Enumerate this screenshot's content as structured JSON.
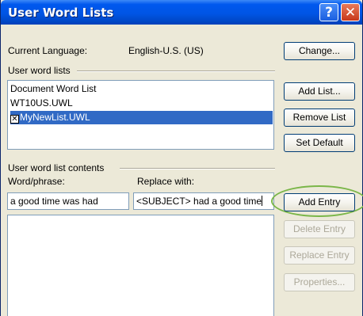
{
  "window": {
    "title": "User Word Lists"
  },
  "titlebar": {
    "help_glyph": "?",
    "close_glyph": "✕"
  },
  "language": {
    "label": "Current Language:",
    "value": "English-U.S. (US)",
    "change_button": "Change..."
  },
  "word_lists": {
    "group_label": "User word lists",
    "items": [
      {
        "label": "Document Word List",
        "checked": false,
        "selected": false
      },
      {
        "label": "WT10US.UWL",
        "checked": false,
        "selected": false
      },
      {
        "label": "MyNewList.UWL",
        "checked": true,
        "selected": true
      }
    ],
    "add_button": "Add List...",
    "remove_button": "Remove List",
    "default_button": "Set Default"
  },
  "contents": {
    "group_label": "User word list contents",
    "word_label": "Word/phrase:",
    "replace_label": "Replace with:",
    "word_value": "a good time was had",
    "replace_value": "<SUBJECT> had a good time",
    "add_entry_button": "Add Entry",
    "delete_entry_button": "Delete Entry",
    "replace_entry_button": "Replace Entry",
    "properties_button": "Properties..."
  },
  "colors": {
    "selection": "#316ac5",
    "highlight_ring": "#7ab648"
  }
}
